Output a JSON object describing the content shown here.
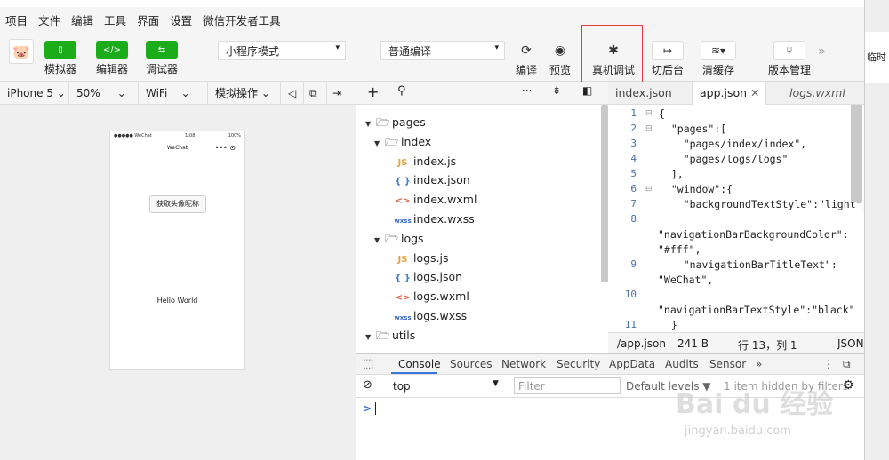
{
  "menubar": [
    "项目",
    "文件",
    "编辑",
    "工具",
    "界面",
    "设置",
    "微信开发者工具"
  ],
  "toolbar": {
    "simulator": "模拟器",
    "editor": "编辑器",
    "debugger": "调试器",
    "mode": "小程序模式",
    "compile_mode": "普通编译",
    "compile": "编译",
    "preview": "预览",
    "remote_debug": "真机调试",
    "background": "切后台",
    "clear_cache": "清缓存",
    "version": "版本管理"
  },
  "simbar": {
    "device": "iPhone 5",
    "zoom": "50%",
    "network": "WiFi",
    "operation": "模拟操作"
  },
  "phone": {
    "carrier": "●●●●● WeChat",
    "time": "1:08",
    "battery": "100%",
    "title": "WeChat",
    "button": "获取头像昵称",
    "hello": "Hello World"
  },
  "tree": [
    {
      "label": "pages",
      "kind": "folder",
      "arrow": "▼",
      "indent": 0
    },
    {
      "label": "index",
      "kind": "folder",
      "arrow": "▼",
      "indent": 1
    },
    {
      "label": "index.js",
      "kind": "js",
      "indent": 2
    },
    {
      "label": "index.json",
      "kind": "json",
      "indent": 2
    },
    {
      "label": "index.wxml",
      "kind": "wxml",
      "indent": 2
    },
    {
      "label": "index.wxss",
      "kind": "wxss",
      "indent": 2
    },
    {
      "label": "logs",
      "kind": "folder",
      "arrow": "▼",
      "indent": 1
    },
    {
      "label": "logs.js",
      "kind": "js",
      "indent": 2
    },
    {
      "label": "logs.json",
      "kind": "json",
      "indent": 2
    },
    {
      "label": "logs.wxml",
      "kind": "wxml",
      "indent": 2
    },
    {
      "label": "logs.wxss",
      "kind": "wxss",
      "indent": 2
    },
    {
      "label": "utils",
      "kind": "folder",
      "arrow": "▼",
      "indent": 0
    }
  ],
  "tabs": [
    "index.json",
    "app.json",
    "logs.wxml"
  ],
  "code": [
    {
      "n": "1",
      "t": "{"
    },
    {
      "n": "2",
      "t": "  \"pages\":["
    },
    {
      "n": "3",
      "t": "    \"pages/index/index\","
    },
    {
      "n": "4",
      "t": "    \"pages/logs/logs\""
    },
    {
      "n": "5",
      "t": "  ],"
    },
    {
      "n": "6",
      "t": "  \"window\":{"
    },
    {
      "n": "7",
      "t": "    \"backgroundTextStyle\":\"light\","
    },
    {
      "n": "8",
      "t": ""
    },
    {
      "n": "",
      "t": "\"navigationBarBackgroundColor\":"
    },
    {
      "n": "",
      "t": "\"#fff\","
    },
    {
      "n": "9",
      "t": "    \"navigationBarTitleText\":"
    },
    {
      "n": "",
      "t": "\"WeChat\","
    },
    {
      "n": "10",
      "t": ""
    },
    {
      "n": "",
      "t": "\"navigationBarTextStyle\":\"black\""
    },
    {
      "n": "11",
      "t": "  }"
    }
  ],
  "status": {
    "path": "/app.json",
    "size": "241 B",
    "pos": "行 13，列 1",
    "lang": "JSON"
  },
  "console_tabs": [
    "Console",
    "Sources",
    "Network",
    "Security",
    "AppData",
    "Audits",
    "Sensor"
  ],
  "console": {
    "context": "top",
    "filter_placeholder": "Filter",
    "levels": "Default levels ▼",
    "hidden": "1 item hidden by filters",
    "prompt": ">"
  },
  "right_strip": {
    "label": "临时"
  },
  "watermark": {
    "text": "Bai du 经验",
    "url": "jingyan.baidu.com"
  },
  "colors": {
    "accent": "#1aad19",
    "highlight": "#e23b3b"
  }
}
